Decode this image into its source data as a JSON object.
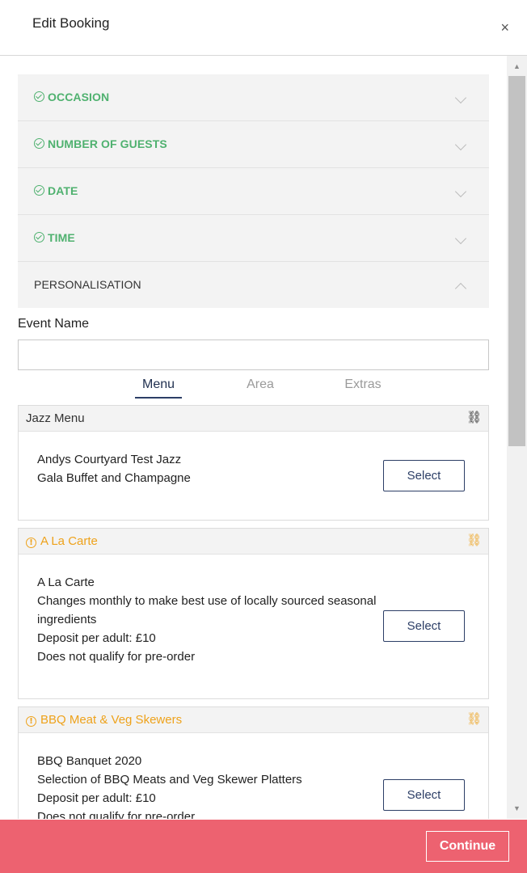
{
  "header": {
    "title": "Edit Booking",
    "close_label": "×"
  },
  "accordion": {
    "items": [
      {
        "label": "OCCASION",
        "complete": true
      },
      {
        "label": "NUMBER OF GUESTS",
        "complete": true
      },
      {
        "label": "DATE",
        "complete": true
      },
      {
        "label": "TIME",
        "complete": true
      },
      {
        "label": "PERSONALISATION",
        "complete": false,
        "expanded": true
      }
    ]
  },
  "personalisation": {
    "event_name_label": "Event Name",
    "event_name_value": "",
    "event_name_placeholder": ""
  },
  "tabs": {
    "menu": "Menu",
    "area": "Area",
    "extras": "Extras",
    "active": "Menu"
  },
  "menus": [
    {
      "title": "Jazz Menu",
      "warning": false,
      "lines": [
        "Andys Courtyard Test Jazz",
        "Gala Buffet and Champagne"
      ],
      "select_label": "Select"
    },
    {
      "title": "A La Carte",
      "warning": true,
      "lines": [
        "A La Carte",
        "Changes monthly to make best use of locally sourced seasonal ingredients",
        "Deposit per adult: £10",
        "Does not qualify for pre-order"
      ],
      "select_label": "Select"
    },
    {
      "title": "BBQ Meat & Veg Skewers",
      "warning": true,
      "lines": [
        "BBQ Banquet 2020",
        "Selection of BBQ Meats and Veg Skewer Platters",
        "Deposit per adult: £10",
        "Does not qualify for pre-order"
      ],
      "select_label": "Select"
    }
  ],
  "icons": {
    "check": "check-circle-icon",
    "chevron": "chevron-icon",
    "warning": "exclamation-circle-icon",
    "link": "link-icon",
    "warning_glyph": "!",
    "link_glyph": "⛓",
    "scroll_up_glyph": "▲",
    "scroll_down_glyph": "▼"
  },
  "colors": {
    "complete_green": "#4fb16f",
    "warning_orange": "#eea21b",
    "navy": "#2c3e66",
    "footer_pink": "#ed6270"
  },
  "footer": {
    "continue_label": "Continue"
  }
}
